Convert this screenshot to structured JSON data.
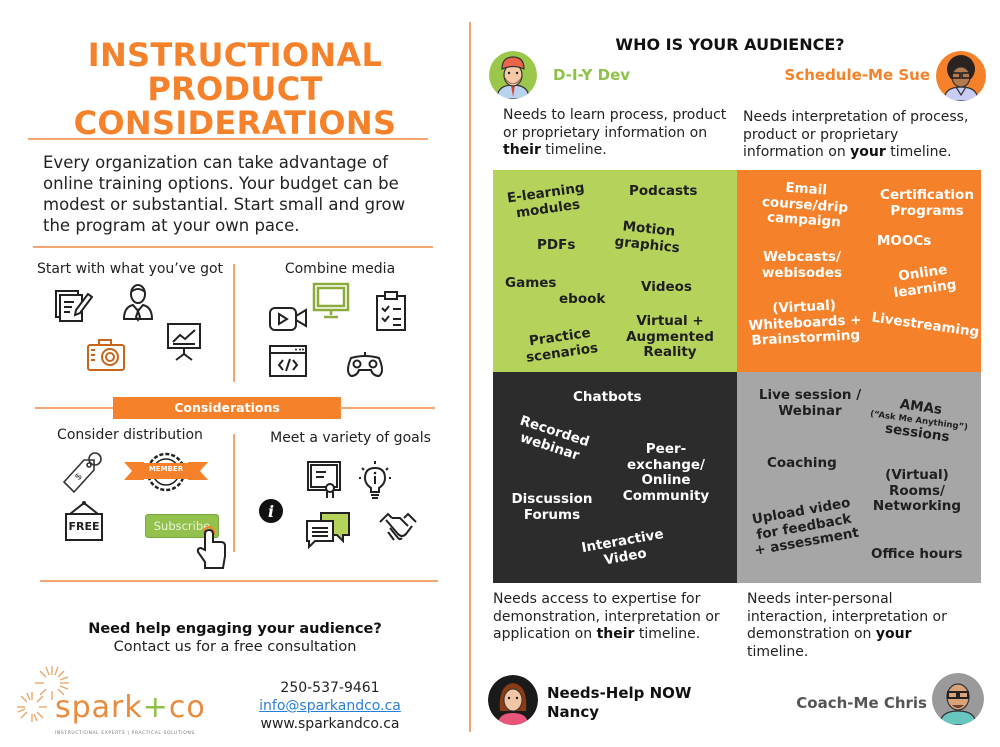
{
  "left": {
    "title_line1": "INSTRUCTIONAL PRODUCT",
    "title_line2": "CONSIDERATIONS",
    "intro": "Every organization can take advantage of online training options. Your budget can be modest or substantial. Start small and grow the program at your own pace.",
    "sections": {
      "start": "Start with what you’ve got",
      "combine": "Combine media",
      "considerations_banner": "Considerations",
      "distribution": "Consider distribution",
      "goals": "Meet a variety of goals"
    },
    "distribution_icons": {
      "member_label": "MEMBER",
      "free_label": "FREE",
      "subscribe_label": "Subscribe"
    },
    "cta": {
      "title": "Need help engaging your audience?",
      "subtitle": "Contact us for a free consultation"
    },
    "contact": {
      "phone": "250-537-9461",
      "email": "info@sparkandco.ca",
      "website": "www.sparkandco.ca"
    },
    "logo": {
      "word_a": "spark",
      "plus": "+",
      "word_b": "co",
      "tagline": "INSTRUCTIONAL EXPERTS | PRACTICAL SOLUTIONS"
    }
  },
  "right": {
    "title": "WHO IS YOUR AUDIENCE?",
    "personas": [
      {
        "name": "D-I-Y Dev",
        "color": "#8dc14a",
        "desc_pre": "Needs to learn process, product or proprietary information on ",
        "desc_bold": "their",
        "desc_post": " timeline."
      },
      {
        "name": "Schedule-Me Sue",
        "color": "#f5822a",
        "desc_pre": "Needs interpretation of process, product or proprietary information on ",
        "desc_bold": "your",
        "desc_post": " timeline."
      },
      {
        "name_line1": "Needs-Help NOW",
        "name_line2": "Nancy",
        "color": "#111111",
        "desc_pre": "Needs access to expertise for demonstration, interpretation or application on ",
        "desc_bold": "their",
        "desc_post": " timeline."
      },
      {
        "name": "Coach-Me Chris",
        "color": "#555555",
        "desc_pre": "Needs inter-personal interaction, interpretation or demonstration on ",
        "desc_bold": "your",
        "desc_post": " timeline."
      }
    ],
    "quadrants": {
      "green": {
        "color": "#b5d35a",
        "items": [
          "E-learning modules",
          "Podcasts",
          "Motion graphics",
          "PDFs",
          "Games",
          "ebook",
          "Videos",
          "Practice scenarios",
          "Virtual + Augmented Reality"
        ]
      },
      "orange": {
        "color": "#f5822a",
        "items": [
          "Email course/drip campaign",
          "Certification Programs",
          "MOOCs",
          "Webcasts/ webisodes",
          "Online learning",
          "(Virtual) Whiteboards + Brainstorming",
          "Livestreaming"
        ]
      },
      "dark": {
        "color": "#2c2c2c",
        "items": [
          "Chatbots",
          "Recorded webinar",
          "Peer-exchange/ Online Community",
          "Discussion Forums",
          "Interactive Video"
        ]
      },
      "gray": {
        "color": "#a6a6a6",
        "items": [
          "Live session / Webinar",
          "AMAs",
          "(“Ask Me Anything”)",
          "sessions",
          "Coaching",
          "(Virtual) Rooms/ Networking",
          "Upload video for feedback + assessment",
          "Office hours"
        ]
      }
    }
  }
}
